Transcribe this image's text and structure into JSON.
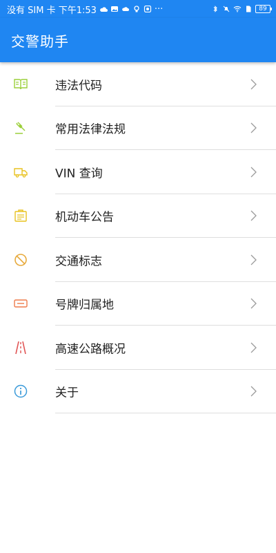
{
  "status_bar": {
    "left_text": "没有 SIM 卡 下午1:53",
    "more": "···",
    "battery": "89"
  },
  "app_bar": {
    "title": "交警助手"
  },
  "menu": [
    {
      "label": "违法代码",
      "icon": "book-icon",
      "color": "#9bcf3a"
    },
    {
      "label": "常用法律法规",
      "icon": "gavel-icon",
      "color": "#9bcf3a"
    },
    {
      "label": "VIN 查询",
      "icon": "truck-icon",
      "color": "#e8c21f"
    },
    {
      "label": "机动车公告",
      "icon": "notice-board-icon",
      "color": "#e8c21f"
    },
    {
      "label": "交通标志",
      "icon": "prohibited-sign-icon",
      "color": "#e7a93a"
    },
    {
      "label": "号牌归属地",
      "icon": "license-plate-icon",
      "color": "#ee7a4a"
    },
    {
      "label": "高速公路概况",
      "icon": "highway-icon",
      "color": "#e05353"
    },
    {
      "label": "关于",
      "icon": "info-icon",
      "color": "#3a9ad9"
    }
  ]
}
